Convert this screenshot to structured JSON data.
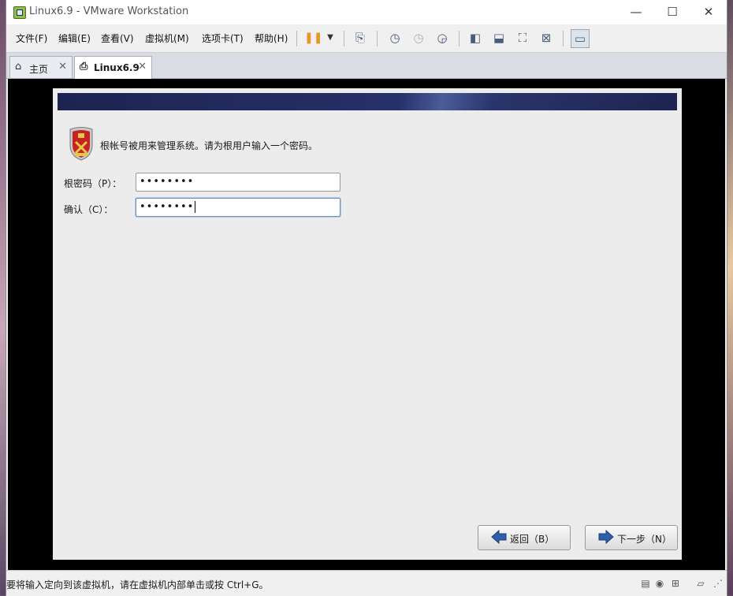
{
  "window": {
    "title": "Linux6.9 - VMware Workstation",
    "controls": {
      "minimize": "—",
      "maximize": "☐",
      "close": "✕"
    }
  },
  "menu": {
    "items": [
      {
        "label": "文件(F)"
      },
      {
        "label": "编辑(E)"
      },
      {
        "label": "查看(V)"
      },
      {
        "label": "虚拟机(M)"
      },
      {
        "label": "选项卡(T)"
      },
      {
        "label": "帮助(H)"
      }
    ]
  },
  "toolbar": {
    "icons": [
      "pause-icon",
      "dropdown-icon",
      "send-ctrl-alt-del-icon",
      "snapshot-icon",
      "revert-snapshot-icon",
      "snapshot-manager-icon",
      "sidebar-icon",
      "thumbnail-icon",
      "fullscreen-icon",
      "unity-icon",
      "console-view-icon"
    ]
  },
  "tabs": [
    {
      "label": "主页",
      "close": "✕"
    },
    {
      "label": "Linux6.9",
      "close": "✕"
    }
  ],
  "installer": {
    "description": "根帐号被用来管理系统。请为根用户输入一个密码。",
    "password_label": "根密码（P）：",
    "password_value": "••••••••",
    "confirm_label": "确认（C）：",
    "confirm_value": "••••••••",
    "back_label": "返回（B）",
    "next_label": "下一步（N）"
  },
  "statusbar": {
    "text": "要将输入定向到该虚拟机，请在虚拟机内部单击或按 Ctrl+G。"
  },
  "colors": {
    "banner": "#1d2450",
    "arrow_blue": "#2f5fa8",
    "pause": "#e8952a"
  }
}
